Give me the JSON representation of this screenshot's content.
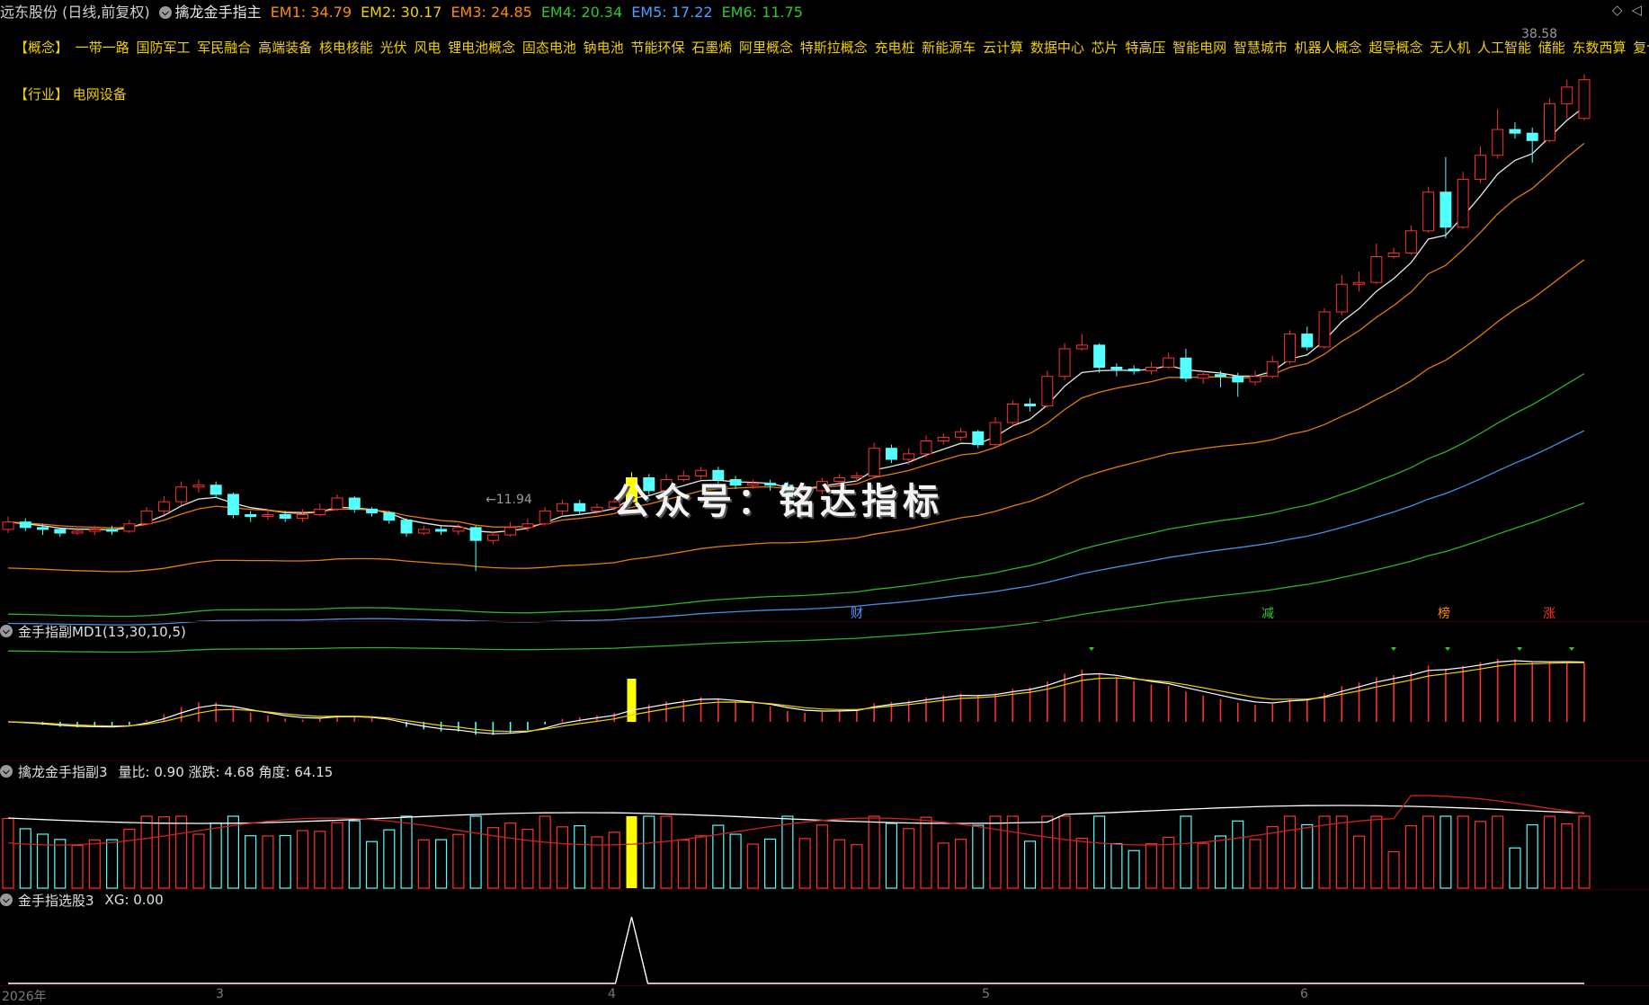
{
  "header": {
    "stock": "远东股份 (日线,前复权)",
    "indicator": "擒龙金手指主",
    "em": [
      {
        "label": "EM1: 34.79",
        "color": "#ff8c00"
      },
      {
        "label": "EM2: 30.17",
        "color": "#f0d000"
      },
      {
        "label": "EM3: 24.85",
        "color": "#ff8c00"
      },
      {
        "label": "EM4: 20.34",
        "color": "#2ec82e"
      },
      {
        "label": "EM5: 17.22",
        "color": "#4aa0ff"
      },
      {
        "label": "EM6: 11.75",
        "color": "#2ec82e"
      }
    ]
  },
  "concepts": "【概念】 一带一路 国防军工 军民融合 高端装备 核电核能 光伏 风电 锂电池概念 固态电池 钠电池 节能环保 石墨烯 阿里概念 特斯拉概念 充电桩 新能源车 云计算 数据中心 芯片 特高压 智能电网 智慧城市 机器人概念 超导概念 无人机 人工智能 储能 东数西算 复合",
  "industry": "【行业】 电网设备",
  "price_labels": {
    "high": "38.58",
    "low": "11.94"
  },
  "watermark": "公众号：铭达指标",
  "events": [
    {
      "label": "财",
      "color": "#4aa0ff"
    },
    {
      "label": "减",
      "color": "#2ec82e"
    },
    {
      "label": "榜",
      "color": "#ff8c00"
    },
    {
      "label": "涨",
      "color": "#ff3030"
    }
  ],
  "panel1": {
    "title": "金手指副MD1(13,30,10,5)"
  },
  "panel2": {
    "title": "擒龙金手指副3",
    "values": "量比: 0.90  涨跌: 4.68  角度: 64.15"
  },
  "panel3": {
    "title": "金手指选股3",
    "values": "XG: 0.00"
  },
  "x_axis": [
    "2026年",
    "3",
    "4",
    "5",
    "6"
  ],
  "colors": {
    "up": "#ff3030",
    "down": "#54ffff",
    "signal": "#ffff00"
  },
  "chart_data": {
    "type": "candlestick",
    "ylim": [
      10,
      40
    ],
    "candles": [
      [
        14.2,
        14.6,
        14.9,
        14.0
      ],
      [
        14.6,
        14.3,
        14.8,
        14.1
      ],
      [
        14.3,
        14.2,
        14.5,
        13.9
      ],
      [
        14.2,
        14.0,
        14.3,
        13.8
      ],
      [
        14.0,
        14.1,
        14.3,
        13.9
      ],
      [
        14.1,
        14.2,
        14.4,
        13.9
      ],
      [
        14.2,
        14.1,
        14.4,
        13.9
      ],
      [
        14.1,
        14.5,
        14.7,
        14.0
      ],
      [
        14.5,
        15.2,
        15.4,
        14.4
      ],
      [
        15.2,
        15.7,
        16.0,
        15.0
      ],
      [
        15.7,
        16.5,
        16.8,
        15.5
      ],
      [
        16.5,
        16.6,
        16.9,
        16.2
      ],
      [
        16.6,
        16.1,
        16.8,
        15.9
      ],
      [
        16.1,
        15.0,
        16.2,
        14.8
      ],
      [
        15.0,
        14.9,
        15.2,
        14.6
      ],
      [
        14.9,
        15.0,
        15.3,
        14.7
      ],
      [
        15.0,
        14.8,
        15.2,
        14.6
      ],
      [
        14.8,
        15.0,
        15.3,
        14.6
      ],
      [
        15.0,
        15.3,
        15.6,
        14.9
      ],
      [
        15.3,
        15.9,
        16.1,
        15.2
      ],
      [
        15.9,
        15.3,
        16.0,
        15.1
      ],
      [
        15.3,
        15.1,
        15.4,
        14.9
      ],
      [
        15.1,
        14.7,
        15.2,
        14.5
      ],
      [
        14.7,
        14.0,
        14.8,
        13.8
      ],
      [
        14.0,
        14.2,
        14.4,
        13.9
      ],
      [
        14.2,
        14.1,
        14.4,
        13.9
      ],
      [
        14.1,
        14.3,
        14.5,
        13.9
      ],
      [
        14.3,
        13.6,
        14.4,
        11.94
      ],
      [
        13.6,
        13.9,
        14.1,
        13.4
      ],
      [
        13.9,
        14.3,
        14.6,
        13.8
      ],
      [
        14.3,
        14.5,
        14.8,
        14.1
      ],
      [
        14.5,
        15.2,
        15.4,
        14.4
      ],
      [
        15.2,
        15.6,
        15.8,
        15.0
      ],
      [
        15.6,
        15.2,
        15.8,
        15.0
      ],
      [
        15.2,
        15.4,
        15.6,
        15.0
      ],
      [
        15.4,
        15.7,
        15.9,
        15.2
      ],
      [
        15.7,
        17.0,
        17.3,
        15.6
      ],
      [
        17.0,
        16.3,
        17.2,
        16.0
      ],
      [
        16.3,
        16.9,
        17.2,
        16.1
      ],
      [
        16.9,
        17.1,
        17.4,
        16.8
      ],
      [
        17.1,
        17.4,
        17.6,
        16.9
      ],
      [
        17.4,
        16.9,
        17.6,
        16.7
      ],
      [
        16.9,
        16.6,
        17.1,
        16.4
      ],
      [
        16.6,
        16.7,
        16.9,
        16.4
      ],
      [
        16.7,
        16.6,
        16.9,
        16.3
      ],
      [
        16.6,
        16.0,
        16.8,
        15.7
      ],
      [
        16.0,
        16.3,
        16.5,
        15.9
      ],
      [
        16.3,
        16.8,
        17.0,
        16.1
      ],
      [
        16.8,
        17.0,
        17.2,
        16.6
      ],
      [
        17.0,
        17.1,
        17.3,
        16.8
      ],
      [
        17.1,
        18.6,
        18.9,
        17.0
      ],
      [
        18.6,
        18.0,
        18.8,
        17.8
      ],
      [
        18.0,
        18.3,
        18.6,
        17.7
      ],
      [
        18.3,
        19.0,
        19.3,
        18.1
      ],
      [
        19.0,
        19.2,
        19.4,
        18.8
      ],
      [
        19.2,
        19.5,
        19.7,
        19.0
      ],
      [
        19.5,
        18.8,
        19.6,
        18.6
      ],
      [
        18.8,
        20.0,
        20.3,
        18.7
      ],
      [
        20.0,
        21.0,
        21.2,
        19.8
      ],
      [
        21.0,
        20.9,
        21.3,
        20.6
      ],
      [
        20.9,
        22.5,
        22.8,
        20.8
      ],
      [
        22.5,
        24.0,
        24.3,
        22.3
      ],
      [
        24.0,
        24.2,
        24.8,
        23.9
      ],
      [
        24.2,
        23.0,
        24.3,
        22.7
      ],
      [
        23.0,
        22.9,
        23.2,
        22.5
      ],
      [
        22.9,
        22.8,
        23.1,
        22.6
      ],
      [
        22.8,
        23.0,
        23.3,
        22.6
      ],
      [
        23.0,
        23.5,
        23.8,
        22.9
      ],
      [
        23.5,
        22.4,
        24.0,
        22.2
      ],
      [
        22.4,
        22.6,
        22.8,
        22.1
      ],
      [
        22.6,
        22.5,
        22.8,
        21.9
      ],
      [
        22.5,
        22.2,
        22.7,
        21.4
      ],
      [
        22.2,
        22.5,
        22.8,
        22.0
      ],
      [
        22.5,
        23.3,
        23.6,
        22.4
      ],
      [
        23.3,
        24.8,
        25.0,
        23.2
      ],
      [
        24.8,
        24.1,
        25.2,
        23.9
      ],
      [
        24.1,
        26.0,
        26.2,
        24.0
      ],
      [
        26.0,
        27.5,
        28.0,
        25.8
      ],
      [
        27.5,
        27.6,
        28.2,
        27.1
      ],
      [
        27.6,
        29.0,
        29.7,
        27.5
      ],
      [
        29.0,
        29.2,
        29.5,
        28.9
      ],
      [
        29.2,
        30.4,
        30.7,
        29.1
      ],
      [
        30.4,
        32.5,
        32.8,
        30.3
      ],
      [
        32.5,
        30.6,
        34.4,
        30.0
      ],
      [
        30.6,
        33.2,
        33.6,
        30.5
      ],
      [
        33.2,
        34.5,
        35.0,
        33.0
      ],
      [
        34.5,
        35.9,
        37.0,
        34.3
      ],
      [
        35.9,
        35.7,
        36.3,
        35.4
      ],
      [
        35.7,
        35.3,
        36.0,
        34.1
      ],
      [
        35.3,
        37.3,
        37.6,
        35.2
      ],
      [
        37.3,
        38.2,
        38.6,
        36.5
      ],
      [
        36.5,
        38.6,
        38.9,
        36.4
      ]
    ]
  }
}
